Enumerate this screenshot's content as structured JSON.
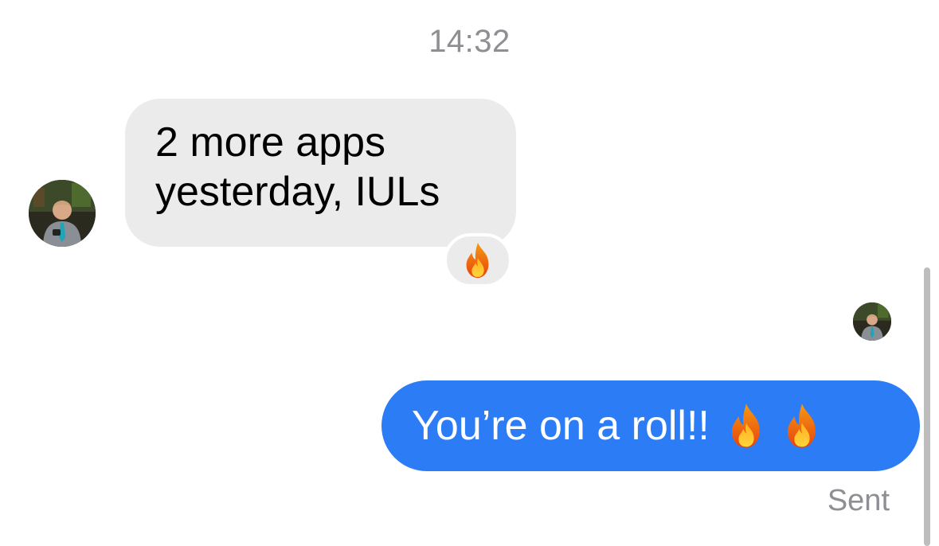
{
  "thread": {
    "timestamp": "14:32"
  },
  "messages": {
    "incoming": {
      "line1": "2 more apps",
      "line2": "yesterday, IULs",
      "reaction_icon": "fire-emoji"
    },
    "outgoing": {
      "text": "You’re on a roll!!",
      "emojis": [
        "fire-emoji",
        "fire-emoji"
      ],
      "status": "Sent"
    }
  },
  "colors": {
    "incoming_bubble": "#ebebeb",
    "outgoing_bubble": "#2c7cf6",
    "meta_text": "#8e8e93"
  }
}
